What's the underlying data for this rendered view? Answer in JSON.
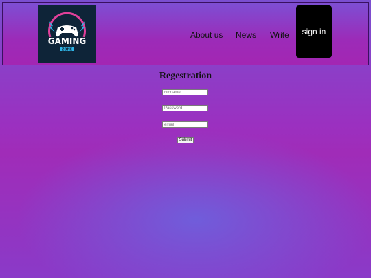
{
  "header": {
    "logo": {
      "text": "GAMING",
      "subtext": "ZONE",
      "icon": "gamepad-icon",
      "colors": {
        "background": "#0e2438",
        "ring": "#e0409a",
        "accent": "#2fb6e8"
      }
    },
    "nav": [
      {
        "label": "About us"
      },
      {
        "label": "News"
      },
      {
        "label": "Write"
      }
    ],
    "signin_label": "sign in"
  },
  "form": {
    "title": "Regestration",
    "nickname_placeholder": "Nicname",
    "password_placeholder": "Password",
    "email_placeholder": "email",
    "submit_label": "Submit"
  },
  "colors": {
    "background_top": "#7a4fd0",
    "background_mid": "#a02cb8",
    "signin_button": "#000000"
  }
}
